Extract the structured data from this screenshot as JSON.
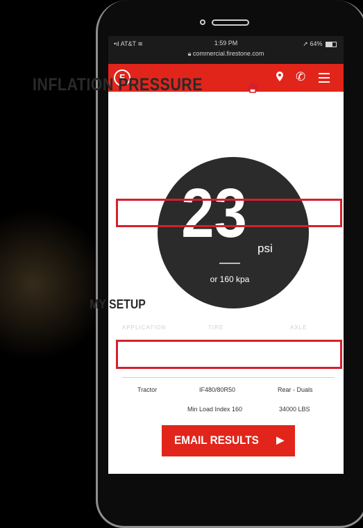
{
  "status_bar": {
    "carrier": "AT&T",
    "time": "1:59 PM",
    "url": "commercial.firestone.com",
    "battery": "64%"
  },
  "nav": {
    "logo_letter": "F",
    "location_icon": "location-pin-icon",
    "phone_icon": "phone-icon",
    "menu_icon": "hamburger-menu-icon"
  },
  "page": {
    "title": "INFLATION PRESSURE",
    "print_icon": "print-icon"
  },
  "pressure": {
    "value": "23",
    "unit": "psi",
    "alt": "or 160 kpa"
  },
  "setup": {
    "title": "MY SETUP",
    "headers": [
      "APPLICATION",
      "TIRE",
      "AXLE"
    ],
    "rows": [
      [
        "Tractor",
        "IF480/80R50",
        "Rear - Duals"
      ],
      [
        "",
        "Min Load Index 160",
        "34000 LBS"
      ]
    ]
  },
  "email_button": {
    "label": "EMAIL RESULTS",
    "arrow": "▶"
  },
  "colors": {
    "brand_red": "#e1251b",
    "circle": "#2b2b2b",
    "highlight_box": "#d4202b"
  }
}
